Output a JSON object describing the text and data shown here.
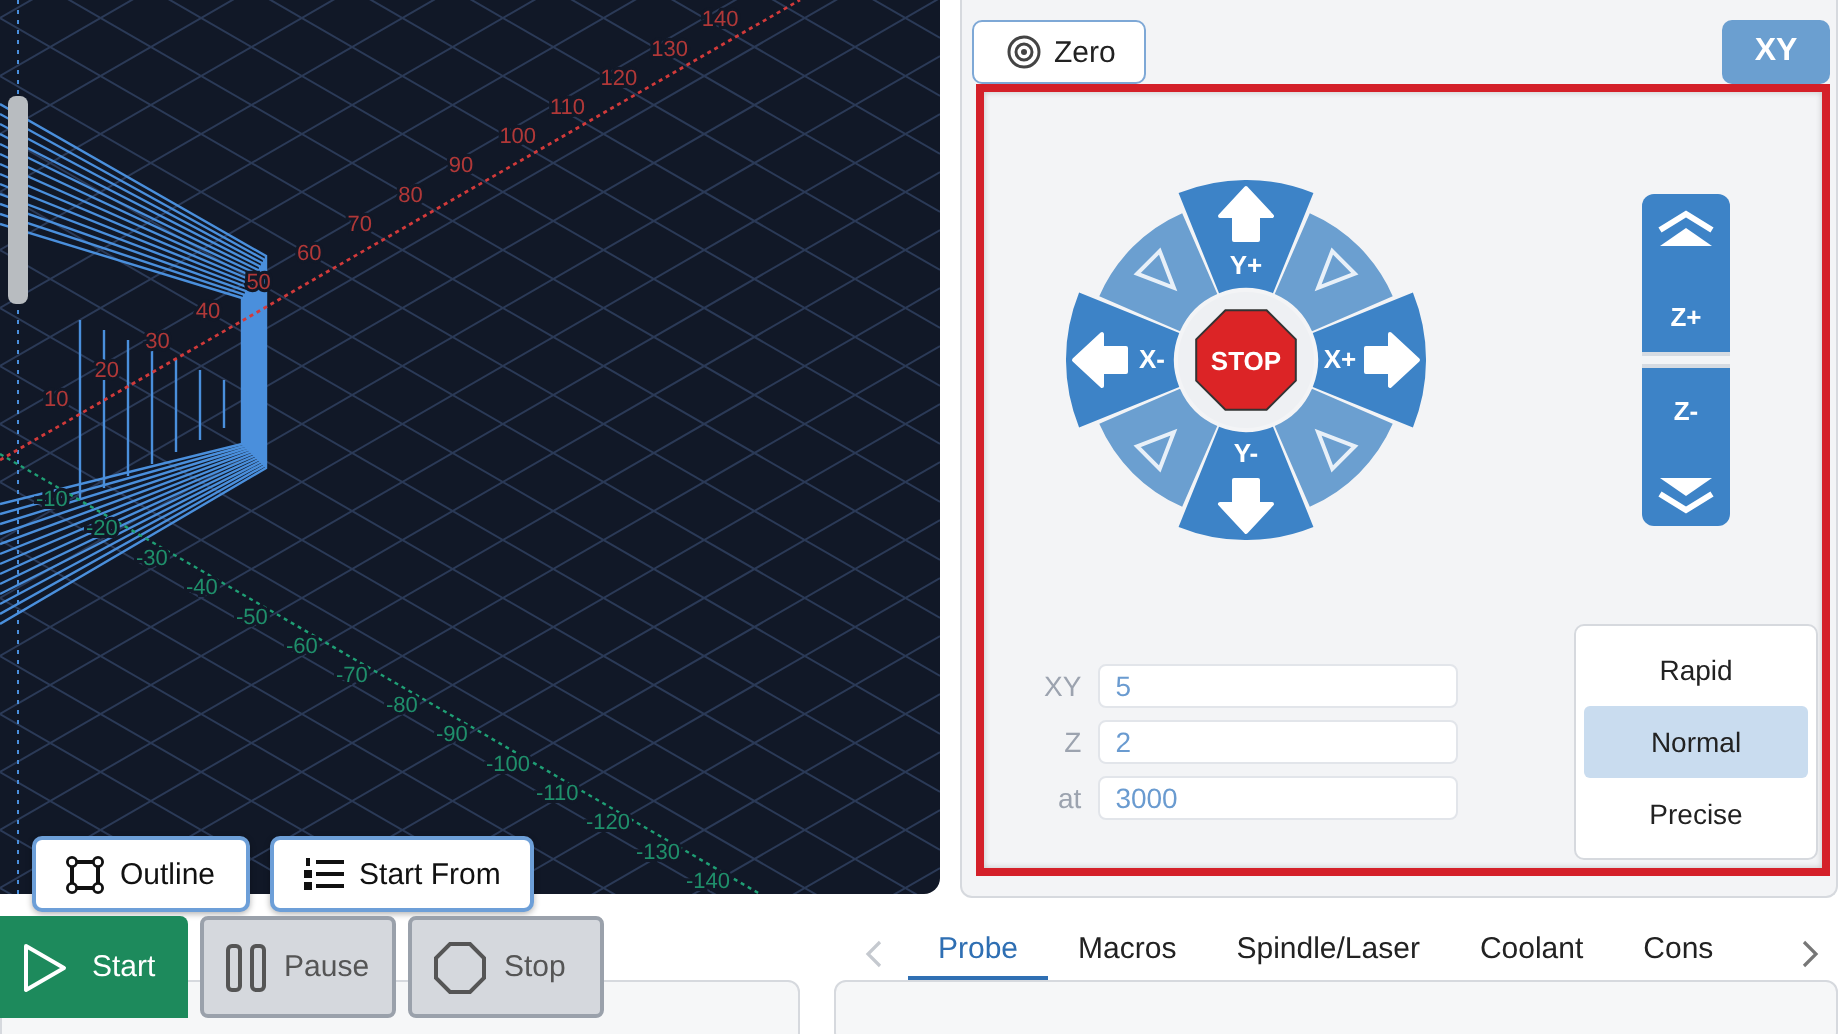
{
  "viewer": {
    "x_axis_labels": [
      "10",
      "20",
      "30",
      "40",
      "50",
      "60",
      "70",
      "80",
      "90",
      "100",
      "110",
      "120",
      "130",
      "140"
    ],
    "y_axis_labels": [
      "-10",
      "-20",
      "-30",
      "-40",
      "-50",
      "-60",
      "-70",
      "-80",
      "-90",
      "-100",
      "-110",
      "-120",
      "-130",
      "-140"
    ],
    "buttons": [
      {
        "label": "Outline",
        "kind": "outline"
      },
      {
        "label": "Start From",
        "kind": "start-from"
      }
    ]
  },
  "jog_panel": {
    "zero_button": {
      "label": "Zero"
    },
    "plane_button": {
      "label": "XY"
    },
    "stop_label": "STOP",
    "axes": [
      {
        "label": "Y+",
        "kind": "up"
      },
      {
        "label": "X+",
        "kind": "right"
      },
      {
        "label": "Y-",
        "kind": "down"
      },
      {
        "label": "X-",
        "kind": "left"
      }
    ],
    "z_buttons": [
      {
        "label": "Z+",
        "kind": "up"
      },
      {
        "label": "Z-",
        "kind": "down"
      }
    ],
    "fields": [
      {
        "label": "XY",
        "value": "5"
      },
      {
        "label": "Z",
        "value": "2"
      },
      {
        "label": "at",
        "value": "3000"
      }
    ],
    "modes": [
      {
        "label": "Rapid",
        "selected": false
      },
      {
        "label": "Normal",
        "selected": true
      },
      {
        "label": "Precise",
        "selected": false
      }
    ]
  },
  "run_controls": [
    {
      "label": "Start",
      "kind": "start"
    },
    {
      "label": "Pause",
      "kind": "pause"
    },
    {
      "label": "Stop",
      "kind": "stop"
    }
  ],
  "tabs": [
    {
      "label": "Probe",
      "selected": true
    },
    {
      "label": "Macros",
      "selected": false
    },
    {
      "label": "Spindle/Laser",
      "selected": false
    },
    {
      "label": "Coolant",
      "selected": false
    },
    {
      "label": "Cons",
      "selected": false
    }
  ]
}
